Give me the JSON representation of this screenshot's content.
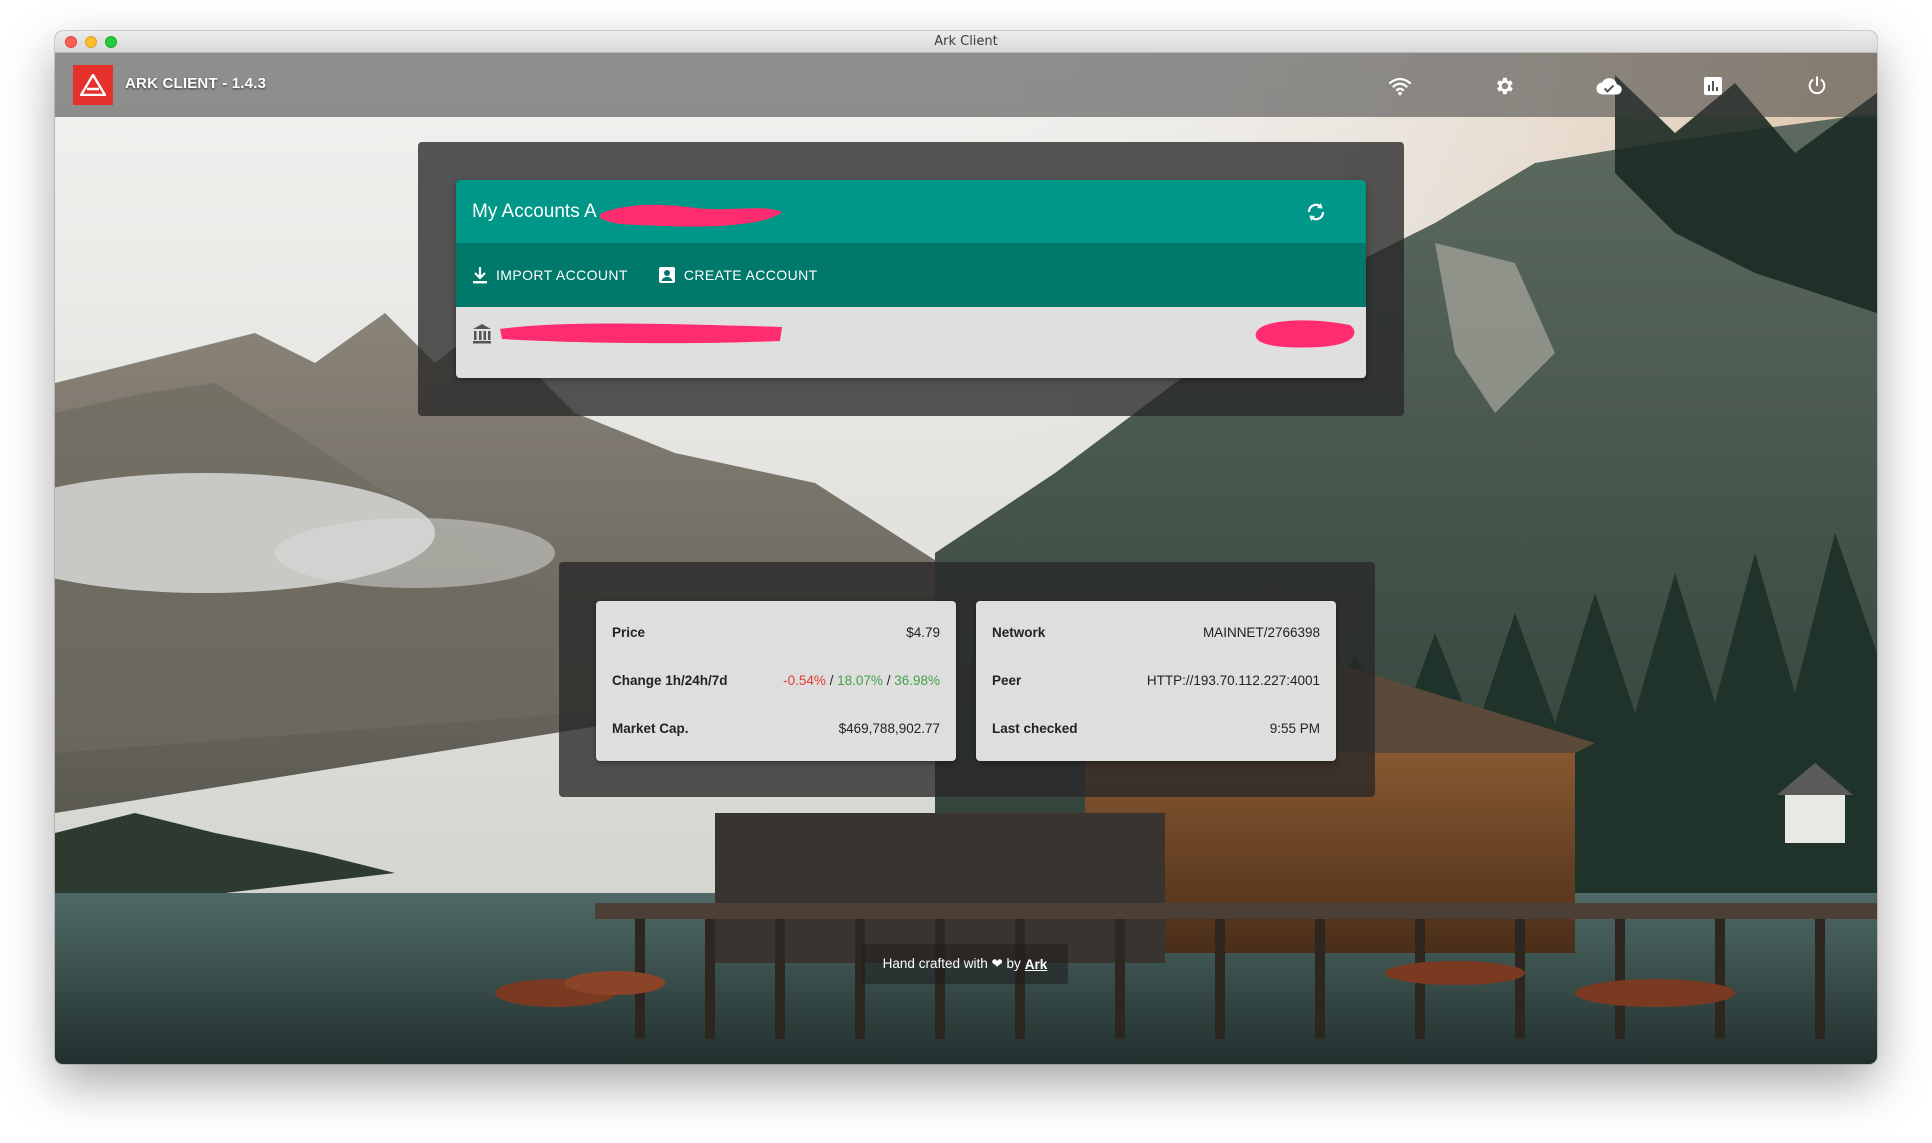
{
  "window": {
    "title": "Ark Client"
  },
  "app": {
    "name": "ARK CLIENT - 1.4.3"
  },
  "toolbar": {
    "icons": [
      "wifi-icon",
      "settings-icon",
      "cloud-check-icon",
      "chart-icon",
      "power-icon"
    ]
  },
  "accounts": {
    "title": "My Accounts",
    "title_suffix": "A",
    "import_label": "IMPORT ACCOUNT",
    "create_label": "CREATE ACCOUNT"
  },
  "market": {
    "rows": [
      {
        "label": "Price",
        "value": "$4.79"
      },
      {
        "label": "Change 1h/24h/7d",
        "change_1h": "-0.54%",
        "sep": " / ",
        "change_24h": "18.07%",
        "change_7d": "36.98%"
      },
      {
        "label": "Market Cap.",
        "value": "$469,788,902.77"
      }
    ]
  },
  "network": {
    "rows": [
      {
        "label": "Network",
        "value": "MAINNET/2766398"
      },
      {
        "label": "Peer",
        "value": "HTTP://193.70.112.227:4001"
      },
      {
        "label": "Last checked",
        "value": "9:55 PM"
      }
    ]
  },
  "footer": {
    "text": "Hand crafted with ❤ by",
    "link": "Ark"
  },
  "colors": {
    "primary": "#009688",
    "primary_dark": "#00796b",
    "logo_red": "#e5302b",
    "negative": "#e53935",
    "positive": "#43a047",
    "redaction": "#ff2d6f"
  }
}
